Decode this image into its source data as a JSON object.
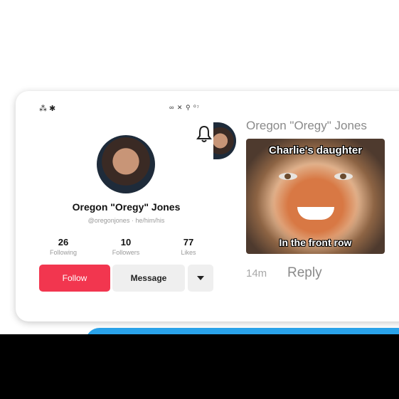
{
  "status_bar": {
    "left": "⁂ ✱",
    "right": "∞ ✕ ⚲ ⁰⁷"
  },
  "profile": {
    "name": "Oregon \"Oregy\" Jones",
    "handle": "@oregonjones · he/him/his",
    "stats": [
      {
        "value": "26",
        "label": "Following"
      },
      {
        "value": "10",
        "label": "Followers"
      },
      {
        "value": "77",
        "label": "Likes"
      }
    ],
    "follow_label": "Follow",
    "message_label": "Message"
  },
  "comment": {
    "author": "Oregon \"Oregy\" Jones",
    "meme_top_caption": "Charlie's daughter",
    "meme_bottom_caption": "In the front row",
    "time": "14m",
    "reply_label": "Reply"
  },
  "icons": {
    "bell": "bell-icon",
    "more": "caret-down-icon"
  },
  "colors": {
    "follow": "#f2364f",
    "accent_blue": "#2aa3ea"
  }
}
